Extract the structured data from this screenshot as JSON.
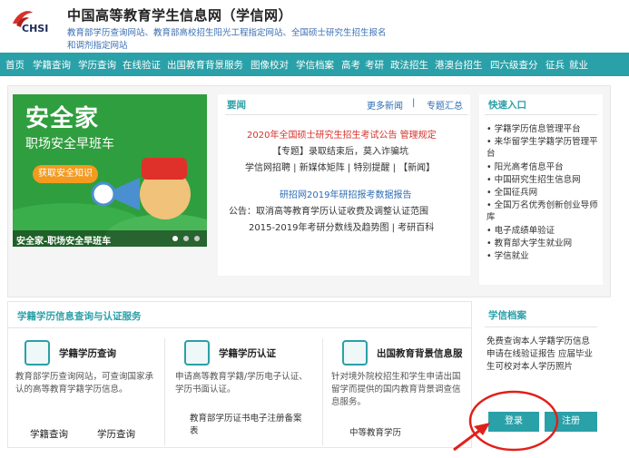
{
  "header": {
    "logo_text": "CHSI",
    "title": "中国高等教育学生信息网（学信网）",
    "subtitle_line1": "教育部学历查询网站、教育部高校招生阳光工程指定网站、全国硕士研究生招生报名",
    "subtitle_line2": "和调剂指定网站"
  },
  "nav": {
    "items": [
      "首页",
      "学籍查询",
      "学历查询",
      "在线验证",
      "出国教育背景服务",
      "图像校对",
      "学信档案",
      "高考",
      "考研",
      "政法招生",
      "港澳台招生",
      "四六级查分",
      "征兵",
      "就业"
    ]
  },
  "banner": {
    "title": "安全家",
    "subtitle": "职场安全早班车",
    "button": "获取安全知识",
    "caption": "安全家-职场安全早班车"
  },
  "news": {
    "title": "要闻",
    "more": "更多新闻",
    "topics": "专题汇总",
    "headline": "2020年全国硕士研究生招生考试公告 管理规定",
    "line2": "【专题】录取结束后，莫入诈骗坑",
    "line3": "学信网招聘 | 新媒体矩阵 | 特别提醒 | 【新闻】",
    "line4": "研招网2019年研招报考数据报告",
    "line5": "公告：取消高等教育学历认证收费及调整认证范围",
    "line6": "2015-2019年考研分数线及趋势图 | 考研百科"
  },
  "quick": {
    "title": "快速入口",
    "items": [
      "• 学籍学历信息管理平台",
      "• 来华留学生学籍学历管理平台",
      "• 阳光高考信息平台",
      "• 中国研究生招生信息网",
      "• 全国征兵网",
      "• 全国万名优秀创新创业导师库",
      "• 电子成绩单验证",
      "• 教育部大学生就业网",
      "• 学信就业"
    ]
  },
  "services": {
    "title": "学籍学历信息查询与认证服务",
    "col1": {
      "title": "学籍学历查询",
      "desc": "教育部学历查询网站，可查询国家承认的高等教育学籍学历信息。",
      "link1": "学籍查询",
      "link2": "学历查询"
    },
    "col2": {
      "title": "学籍学历认证",
      "desc": "申请高等教育学籍/学历电子认证、学历书面认证。",
      "link1": "教育部学历证书电子注册备案表"
    },
    "col3": {
      "title": "出国教育背景信息服",
      "desc": "针对境外院校招生和学生申请出国留学而提供的国内教育背景调查信息服务。",
      "link1": "中等教育学历"
    }
  },
  "files": {
    "title": "学信档案",
    "desc": "免费查询本人学籍学历信息 申请在线验证报告 应届毕业生可校对本人学历照片",
    "login": "登录",
    "register": "注册"
  },
  "colors": {
    "accent": "#2aa0a8",
    "headline": "#d6322c",
    "annotation": "#e0201a"
  }
}
